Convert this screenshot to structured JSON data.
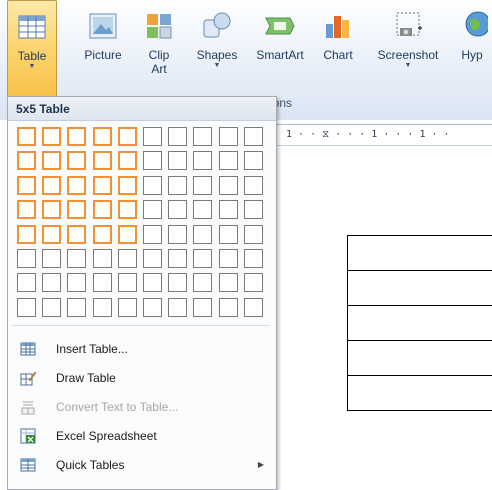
{
  "ribbon": {
    "buttons": [
      {
        "label": "Table",
        "has_arrow": true
      },
      {
        "label": "Picture"
      },
      {
        "label": "Clip Art"
      },
      {
        "label": "Shapes",
        "has_arrow": true
      },
      {
        "label": "SmartArt"
      },
      {
        "label": "Chart"
      },
      {
        "label": "Screenshot",
        "has_arrow": true
      },
      {
        "label": "Hyp"
      }
    ],
    "group_label": "ions"
  },
  "ruler": {
    "text": "1 · · ⧖ · · · 1 · · · 1 · ·"
  },
  "menu": {
    "header": "5x5 Table",
    "grid": {
      "columns": 10,
      "rows": 8,
      "selected_columns": 5,
      "selected_rows": 5
    },
    "items": [
      {
        "label": "Insert Table...",
        "icon": "insert-table-icon",
        "enabled": true
      },
      {
        "label": "Draw Table",
        "icon": "draw-table-icon",
        "enabled": true
      },
      {
        "label": "Convert Text to Table...",
        "icon": "convert-text-table-icon",
        "enabled": false
      },
      {
        "label": "Excel Spreadsheet",
        "icon": "excel-spreadsheet-icon",
        "enabled": true
      },
      {
        "label": "Quick Tables",
        "icon": "quick-tables-icon",
        "enabled": true,
        "submenu": true
      }
    ]
  },
  "document": {
    "table_rows": 5
  }
}
